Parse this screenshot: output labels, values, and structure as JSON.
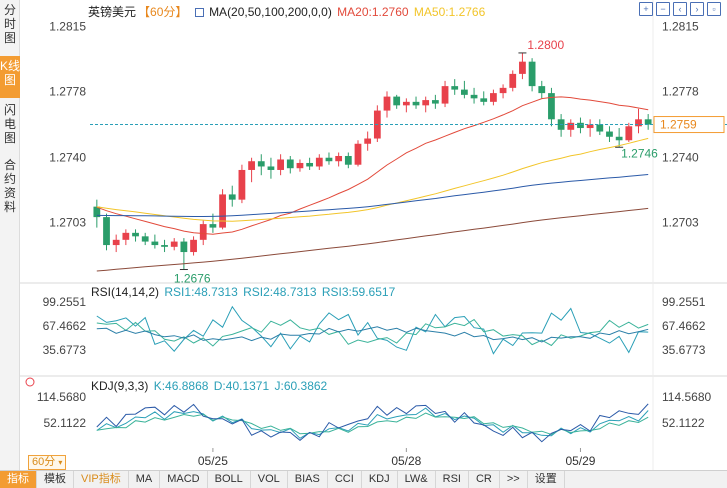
{
  "side_tabs": [
    {
      "label": "分时图",
      "active": false
    },
    {
      "label": "K线图",
      "active": true
    },
    {
      "label": "闪电图",
      "active": false
    },
    {
      "label": "合约资料",
      "active": false
    }
  ],
  "header": {
    "symbol": "英镑美元",
    "period": "【60分】",
    "ma_label": "MA(20,50,100,200,0,0)",
    "ma20": "MA20:1.2760",
    "ma50": "MA50:1.2766"
  },
  "price_axis": {
    "left": [
      "1.2815",
      "1.2778",
      "1.2740",
      "1.2703"
    ],
    "right": [
      "1.2815",
      "1.2778",
      "1.2740",
      "1.2703"
    ],
    "current": "1.2759"
  },
  "annotations": {
    "high": "1.2800",
    "low": "1.2676",
    "recent_low": "1.2746"
  },
  "rsi": {
    "label": "RSI(14,14,2)",
    "rsi1": "RSI1:48.7313",
    "rsi2": "RSI2:48.7313",
    "rsi3": "RSI3:59.6517",
    "ticks": [
      "99.2551",
      "67.4662",
      "35.6773"
    ]
  },
  "kdj": {
    "label": "KDJ(9,3,3)",
    "k": "K:46.8868",
    "d": "D:40.1371",
    "j": "J:60.3862",
    "ticks": [
      "114.5680",
      "52.1122"
    ]
  },
  "dates": [
    "05/25",
    "05/28",
    "05/29"
  ],
  "period_selector": "60分",
  "bottom_tabs": [
    {
      "label": "指标",
      "active": true
    },
    {
      "label": "模板"
    },
    {
      "label": "VIP指标",
      "vip": true
    },
    {
      "label": "MA"
    },
    {
      "label": "MACD"
    },
    {
      "label": "BOLL"
    },
    {
      "label": "VOL"
    },
    {
      "label": "BIAS"
    },
    {
      "label": "CCI"
    },
    {
      "label": "KDJ"
    },
    {
      "label": "LW&"
    },
    {
      "label": "RSI"
    },
    {
      "label": "CR"
    },
    {
      "label": ">>"
    },
    {
      "label": "设置"
    }
  ],
  "toolbar_icons": [
    "zoom-in-icon",
    "zoom-out-icon",
    "move-left-icon",
    "move-right-icon",
    "fullscreen-icon"
  ],
  "colors": {
    "up": "#e8414b",
    "down": "#2a9d6a",
    "ma20": "#e24a3b",
    "ma50": "#f2c52a",
    "ma100": "#2b5aa8",
    "ma200": "#8b4a3a",
    "accent": "#f39c32",
    "current_line": "#2a9fb7"
  },
  "chart_data": {
    "type": "candlestick",
    "ylim": [
      1.267,
      1.282
    ],
    "candles": [
      [
        1.2712,
        1.2716,
        1.27,
        1.2706
      ],
      [
        1.2706,
        1.2708,
        1.2687,
        1.269
      ],
      [
        1.269,
        1.2696,
        1.2686,
        1.2693
      ],
      [
        1.2693,
        1.2699,
        1.269,
        1.2697
      ],
      [
        1.2697,
        1.2699,
        1.2692,
        1.2695
      ],
      [
        1.2695,
        1.2697,
        1.269,
        1.2692
      ],
      [
        1.2692,
        1.2696,
        1.2688,
        1.269
      ],
      [
        1.269,
        1.2693,
        1.2686,
        1.2689
      ],
      [
        1.2689,
        1.2694,
        1.2687,
        1.2692
      ],
      [
        1.2692,
        1.2694,
        1.2676,
        1.2686
      ],
      [
        1.2686,
        1.2695,
        1.2684,
        1.2693
      ],
      [
        1.2693,
        1.2704,
        1.269,
        1.2702
      ],
      [
        1.2702,
        1.2708,
        1.2697,
        1.27
      ],
      [
        1.27,
        1.2722,
        1.2699,
        1.2719
      ],
      [
        1.2719,
        1.2724,
        1.2712,
        1.2716
      ],
      [
        1.2716,
        1.2736,
        1.2714,
        1.2733
      ],
      [
        1.2733,
        1.274,
        1.2726,
        1.2738
      ],
      [
        1.2738,
        1.2742,
        1.273,
        1.2735
      ],
      [
        1.2735,
        1.274,
        1.2728,
        1.2733
      ],
      [
        1.2733,
        1.2742,
        1.273,
        1.2739
      ],
      [
        1.2739,
        1.2741,
        1.2731,
        1.2734
      ],
      [
        1.2734,
        1.2739,
        1.2732,
        1.2737
      ],
      [
        1.2737,
        1.274,
        1.2733,
        1.2735
      ],
      [
        1.2735,
        1.2742,
        1.2733,
        1.274
      ],
      [
        1.274,
        1.2743,
        1.2736,
        1.2738
      ],
      [
        1.2738,
        1.2743,
        1.2735,
        1.2741
      ],
      [
        1.2741,
        1.2743,
        1.2734,
        1.2736
      ],
      [
        1.2736,
        1.275,
        1.2735,
        1.2748
      ],
      [
        1.2748,
        1.2755,
        1.2744,
        1.2751
      ],
      [
        1.2751,
        1.277,
        1.2749,
        1.2767
      ],
      [
        1.2767,
        1.2778,
        1.2763,
        1.2775
      ],
      [
        1.2775,
        1.2776,
        1.2768,
        1.277
      ],
      [
        1.277,
        1.2774,
        1.2766,
        1.2772
      ],
      [
        1.2772,
        1.2775,
        1.2768,
        1.277
      ],
      [
        1.277,
        1.2775,
        1.2766,
        1.2773
      ],
      [
        1.2773,
        1.2776,
        1.2768,
        1.2771
      ],
      [
        1.2771,
        1.2784,
        1.2769,
        1.2781
      ],
      [
        1.2781,
        1.2785,
        1.2776,
        1.2779
      ],
      [
        1.2779,
        1.2784,
        1.2774,
        1.2776
      ],
      [
        1.2776,
        1.278,
        1.2771,
        1.2774
      ],
      [
        1.2774,
        1.2778,
        1.277,
        1.2772
      ],
      [
        1.2772,
        1.2779,
        1.277,
        1.2777
      ],
      [
        1.2777,
        1.2782,
        1.2774,
        1.278
      ],
      [
        1.278,
        1.279,
        1.2778,
        1.2788
      ],
      [
        1.2788,
        1.28,
        1.2785,
        1.2795
      ],
      [
        1.2795,
        1.2797,
        1.2778,
        1.2781
      ],
      [
        1.2781,
        1.2784,
        1.2774,
        1.2777
      ],
      [
        1.2777,
        1.278,
        1.2758,
        1.2762
      ],
      [
        1.2762,
        1.2765,
        1.2752,
        1.2756
      ],
      [
        1.2756,
        1.2762,
        1.2752,
        1.276
      ],
      [
        1.276,
        1.2763,
        1.2754,
        1.2757
      ],
      [
        1.2757,
        1.2762,
        1.2752,
        1.2759
      ],
      [
        1.2759,
        1.2762,
        1.2753,
        1.2755
      ],
      [
        1.2755,
        1.2758,
        1.2749,
        1.2752
      ],
      [
        1.2752,
        1.2757,
        1.2746,
        1.275
      ],
      [
        1.275,
        1.276,
        1.2749,
        1.2758
      ],
      [
        1.2758,
        1.2768,
        1.2754,
        1.2762
      ],
      [
        1.2762,
        1.2765,
        1.2756,
        1.2759
      ]
    ]
  }
}
